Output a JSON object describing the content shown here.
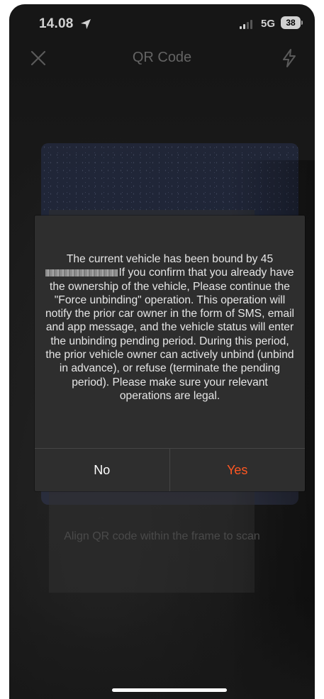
{
  "status_bar": {
    "time": "14.08",
    "location_icon": "location-arrow-icon",
    "signal_icon": "cellular-signal-icon",
    "network": "5G",
    "battery": "38"
  },
  "nav": {
    "title": "QR Code",
    "close_icon": "close-icon",
    "flash_icon": "flash-icon"
  },
  "scanner": {
    "hint": "Align QR code within the frame to scan"
  },
  "dialog": {
    "message_line1": "The current vehicle has been bound by 45",
    "message_rest": "If you confirm that you already have the ownership of the vehicle, Please continue the \"Force unbinding\" operation. This operation will notify the prior car owner in the form of SMS, email and app message, and the vehicle status will enter the unbinding pending period. During this period, the prior vehicle owner can actively unbind (unbind in advance), or refuse (terminate the pending period). Please make sure your relevant operations are legal.",
    "no_label": "No",
    "yes_label": "Yes"
  },
  "colors": {
    "accent": "#ff5722",
    "dialog_bg": "#2e2e2e"
  }
}
